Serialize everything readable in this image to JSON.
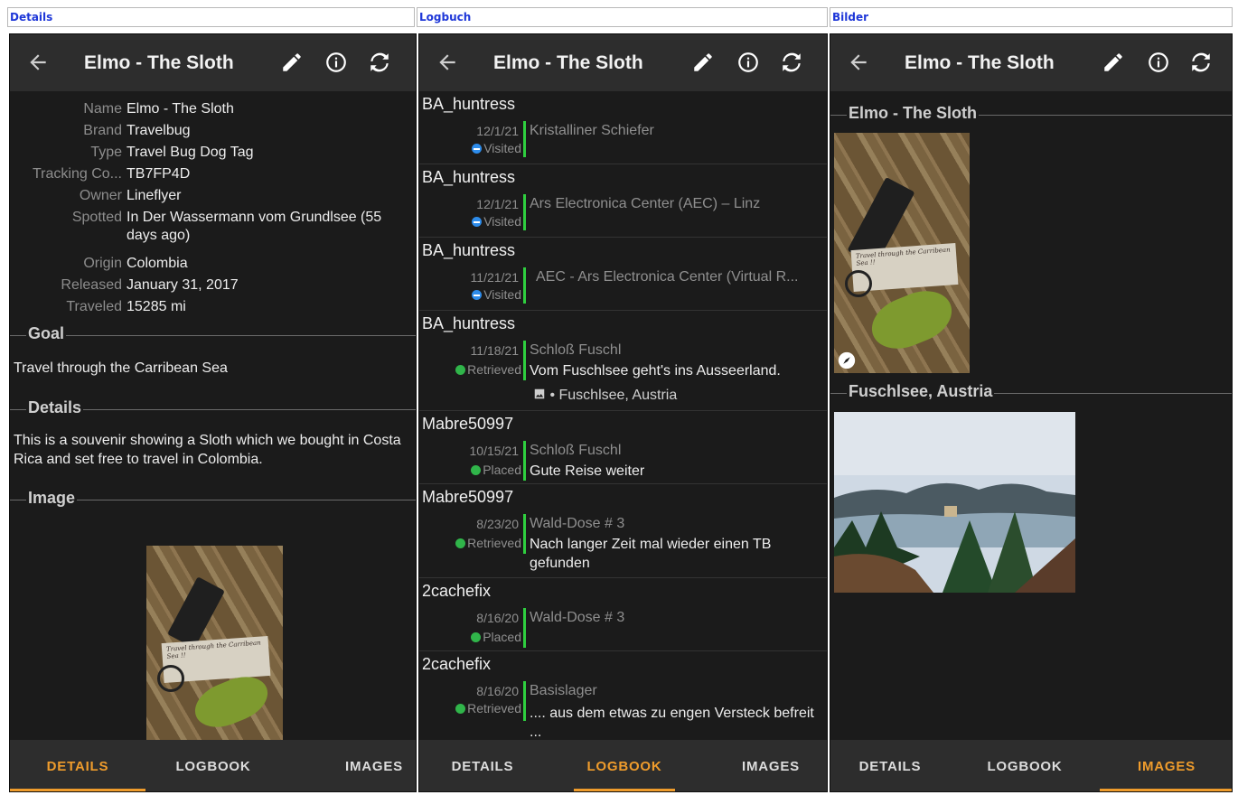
{
  "columns": [
    "Details",
    "Logbuch",
    "Bilder"
  ],
  "appbar": {
    "title": "Elmo - The Sloth"
  },
  "icons": {
    "back": "arrow-left-icon",
    "edit": "pencil-icon",
    "info": "info-icon",
    "refresh": "refresh-icon"
  },
  "colors": {
    "background": "#1b1b1b",
    "appbar": "#2d2d2d",
    "accent": "#ef9c2c",
    "log_bar": "#2fcf3f",
    "visited": "#2d8ceb",
    "link": "#1e37d8"
  },
  "nav": {
    "details": "DETAILS",
    "logbook": "LOGBOOK",
    "images": "IMAGES"
  },
  "details": {
    "props": [
      {
        "key": "Name",
        "value": "Elmo - The Sloth"
      },
      {
        "key": "Brand",
        "value": "Travelbug"
      },
      {
        "key": "Type",
        "value": "Travel Bug Dog Tag"
      },
      {
        "key": "Tracking Co...",
        "value": "TB7FP4D"
      },
      {
        "key": "Owner",
        "value": "Lineflyer"
      },
      {
        "key": "Spotted",
        "value": "In Der Wassermann vom Grundlsee (55 days ago)"
      },
      {
        "key": "Origin",
        "value": "Colombia"
      },
      {
        "key": "Released",
        "value": "January 31, 2017"
      },
      {
        "key": "Traveled",
        "value": "15285 mi"
      }
    ],
    "goal_heading": "Goal",
    "goal_text": "Travel through the Carribean Sea",
    "details_heading": "Details",
    "details_text": "This is a souvenir showing a Sloth which we bought in Costa Rica and set free to travel in Colombia.",
    "image_heading": "Image",
    "photo_tag_text": "Travel through the Carribean Sea !!"
  },
  "logbook": {
    "entries": [
      {
        "user": "BA_huntress",
        "date": "12/1/21",
        "cache": "Kristalliner Schiefer",
        "type": "Visited",
        "text": ""
      },
      {
        "user": "BA_huntress",
        "date": "12/1/21",
        "cache": "Ars Electronica Center (AEC) – Linz",
        "type": "Visited",
        "text": ""
      },
      {
        "user": "BA_huntress",
        "date": "11/21/21",
        "cache": "AEC - Ars Electronica Center (Virtual R...",
        "type": "Visited",
        "text": ""
      },
      {
        "user": "BA_huntress",
        "date": "11/18/21",
        "cache": "Schloß Fuschl",
        "type": "Retrieved",
        "text": "Vom Fuschlsee geht's ins Ausseerland.",
        "meta": "• Fuschlsee, Austria"
      },
      {
        "user": "Mabre50997",
        "date": "10/15/21",
        "cache": "Schloß Fuschl",
        "type": "Placed",
        "text": "Gute Reise weiter"
      },
      {
        "user": "Mabre50997",
        "date": "8/23/20",
        "cache": "Wald-Dose # 3",
        "type": "Retrieved",
        "text": "Nach langer Zeit mal wieder einen TB gefunden"
      },
      {
        "user": "2cachefix",
        "date": "8/16/20",
        "cache": "Wald-Dose # 3",
        "type": "Placed",
        "text": ""
      },
      {
        "user": "2cachefix",
        "date": "8/16/20",
        "cache": "Basislager",
        "type": "Retrieved",
        "text": ".... aus dem etwas zu engen Versteck befreit ..."
      }
    ]
  },
  "images": {
    "groups": [
      {
        "heading": "Elmo - The Sloth"
      },
      {
        "heading": "Fuschlsee, Austria"
      }
    ]
  }
}
